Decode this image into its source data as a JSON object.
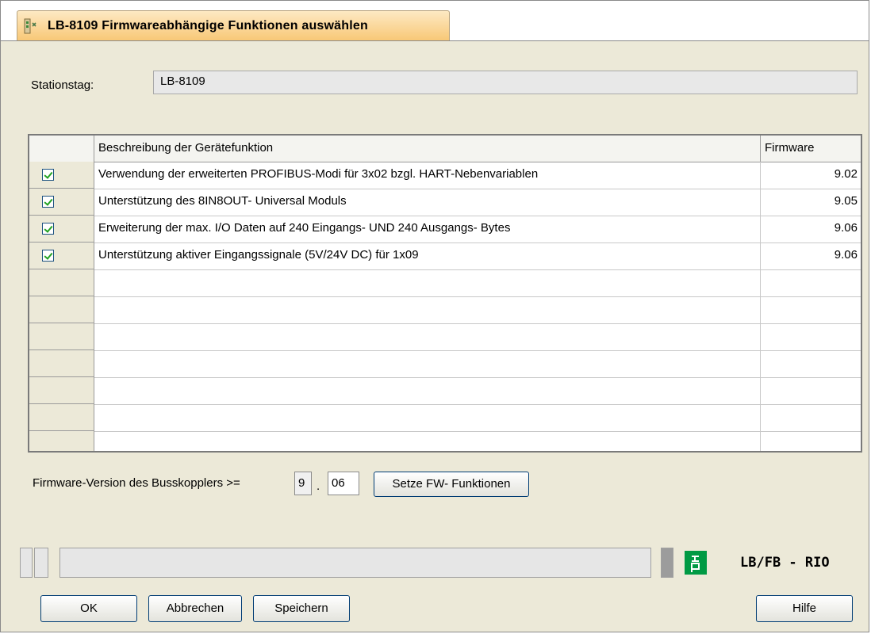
{
  "window": {
    "tab_title": "LB-8109 Firmwareabhängige Funktionen auswählen"
  },
  "station": {
    "label": "Stationstag:",
    "value": "LB-8109"
  },
  "table": {
    "headers": {
      "select": "",
      "description": "Beschreibung der Gerätefunktion",
      "firmware": "Firmware"
    },
    "rows": [
      {
        "checked": true,
        "description": "Verwendung der erweiterten PROFIBUS-Modi für 3x02 bzgl. HART-Nebenvariablen",
        "firmware": "9.02"
      },
      {
        "checked": true,
        "description": "Unterstützung des 8IN8OUT- Universal Moduls",
        "firmware": "9.05"
      },
      {
        "checked": true,
        "description": "Erweiterung der max. I/O Daten auf 240 Eingangs- UND 240 Ausgangs- Bytes",
        "firmware": "9.06"
      },
      {
        "checked": true,
        "description": "Unterstützung aktiver Eingangssignale (5V/24V DC) für 1x09",
        "firmware": "9.06"
      }
    ],
    "empty_rows": 7
  },
  "firmware": {
    "label": "Firmware-Version des Busskopplers >=",
    "major": "9",
    "separator": ".",
    "minor": "06",
    "set_button": "Setze FW- Funktionen"
  },
  "statusbar": {
    "brand_text": "LB/FB - RIO",
    "logo_glyph": "ᵭ6"
  },
  "buttons": {
    "ok": "OK",
    "cancel": "Abbrechen",
    "save": "Speichern",
    "help": "Hilfe"
  },
  "colors": {
    "tab_gradient_top": "#fde9c3",
    "tab_gradient_bottom": "#f8c877",
    "check_green": "#21a121",
    "logo_green": "#009a44",
    "button_border": "#003c74"
  },
  "icons": {
    "tab_icon": "module-icon",
    "check_icon": "checkmark-icon",
    "logo_icon": "pepperl-fuchs-logo-icon"
  }
}
